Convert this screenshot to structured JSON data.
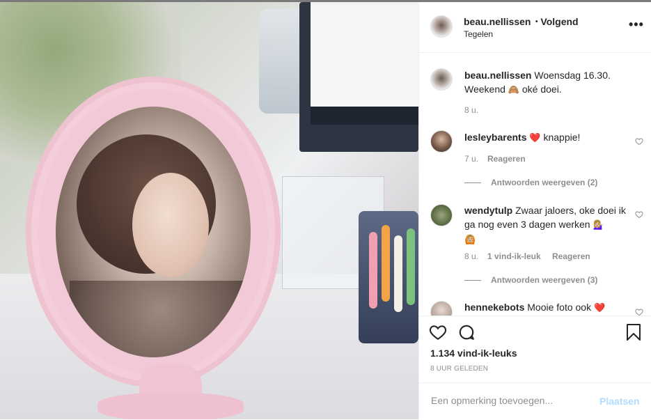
{
  "post": {
    "author": "beau.nellissen",
    "follow_separator": "•",
    "follow_status": "Volgend",
    "location": "Tegelen",
    "more_icon": "more-options-icon"
  },
  "caption": {
    "author": "beau.nellissen",
    "text_1": "Woensdag 16.30.",
    "text_2": "Weekend",
    "emoji_1": "🙈",
    "text_3": "oké doei.",
    "time": "8 u."
  },
  "comments": [
    {
      "author": "lesleybarents",
      "emoji_before": "❤️",
      "text": "knappie!",
      "time": "7 u.",
      "likes": "",
      "reply_label": "Reageren",
      "view_replies": "Antwoorden weergeven (2)"
    },
    {
      "author": "wendytulp",
      "text": "Zwaar jaloers, oke doei ik ga nog even 3 dagen werken",
      "emoji_after": "💁🏼‍♀️",
      "emoji_line2": "🙆🏼",
      "time": "8 u.",
      "likes": "1 vind-ik-leuk",
      "reply_label": "Reageren",
      "view_replies": "Antwoorden weergeven (3)"
    },
    {
      "author": "hennekebots",
      "text": "Mooie foto ook",
      "emoji_after": "❤️"
    }
  ],
  "actions": {
    "like_icon": "heart-icon",
    "comment_icon": "comment-icon",
    "save_icon": "bookmark-icon",
    "likes_count": "1.134 vind-ik-leuks",
    "posted_ago": "8 UUR GELEDEN"
  },
  "add_comment": {
    "placeholder": "Een opmerking toevoegen...",
    "post_label": "Plaatsen"
  },
  "colors": {
    "text": "#262626",
    "muted": "#8e8e8e",
    "post_button_disabled": "#b3dbff",
    "heart_red": "#ed4956"
  }
}
